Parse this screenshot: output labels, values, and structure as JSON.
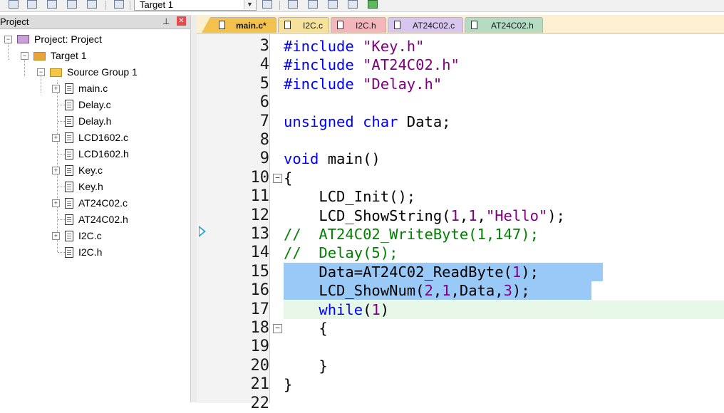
{
  "toolbar": {
    "target_value": "Target 1"
  },
  "project": {
    "title": "Project",
    "tree": [
      {
        "label": "Project: Project",
        "kind": "project",
        "level": 0,
        "expander": "−"
      },
      {
        "label": "Target 1",
        "kind": "target",
        "level": 1,
        "expander": "−"
      },
      {
        "label": "Source Group 1",
        "kind": "folder",
        "level": 2,
        "expander": "−"
      },
      {
        "label": "main.c",
        "kind": "file",
        "level": 3,
        "expander": "+"
      },
      {
        "label": "Delay.c",
        "kind": "file",
        "level": 3,
        "expander": ""
      },
      {
        "label": "Delay.h",
        "kind": "file",
        "level": 3,
        "expander": ""
      },
      {
        "label": "LCD1602.c",
        "kind": "file",
        "level": 3,
        "expander": "+"
      },
      {
        "label": "LCD1602.h",
        "kind": "file",
        "level": 3,
        "expander": ""
      },
      {
        "label": "Key.c",
        "kind": "file",
        "level": 3,
        "expander": "+"
      },
      {
        "label": "Key.h",
        "kind": "file",
        "level": 3,
        "expander": ""
      },
      {
        "label": "AT24C02.c",
        "kind": "file",
        "level": 3,
        "expander": "+"
      },
      {
        "label": "AT24C02.h",
        "kind": "file",
        "level": 3,
        "expander": ""
      },
      {
        "label": "I2C.c",
        "kind": "file",
        "level": 3,
        "expander": "+"
      },
      {
        "label": "I2C.h",
        "kind": "file",
        "level": 3,
        "expander": ""
      }
    ]
  },
  "tabs": [
    "main.c*",
    "I2C.c",
    "I2C.h",
    "AT24C02.c",
    "AT24C02.h"
  ],
  "editor": {
    "lines": [
      {
        "n": "3",
        "fold": "",
        "code": "#include \"Key.h\""
      },
      {
        "n": "4",
        "fold": "",
        "code": "#include \"AT24C02.h\""
      },
      {
        "n": "5",
        "fold": "",
        "code": "#include \"Delay.h\""
      },
      {
        "n": "6",
        "fold": "",
        "code": ""
      },
      {
        "n": "7",
        "fold": "",
        "code": "unsigned char Data;"
      },
      {
        "n": "8",
        "fold": "",
        "code": ""
      },
      {
        "n": "9",
        "fold": "",
        "code": "void main()"
      },
      {
        "n": "10",
        "fold": "⊟",
        "code": "{"
      },
      {
        "n": "11",
        "fold": "",
        "code": "    LCD_Init();"
      },
      {
        "n": "12",
        "fold": "",
        "code": "    LCD_ShowString(1,1,\"Hello\");"
      },
      {
        "n": "13",
        "fold": "",
        "code": "//  AT24C02_WriteByte(1,147);"
      },
      {
        "n": "14",
        "fold": "",
        "code": "//  Delay(5);"
      },
      {
        "n": "15",
        "fold": "",
        "code": "    Data=AT24C02_ReadByte(1);"
      },
      {
        "n": "16",
        "fold": "",
        "code": "    LCD_ShowNum(2,1,Data,3);"
      },
      {
        "n": "17",
        "fold": "",
        "code": "    while(1)"
      },
      {
        "n": "18",
        "fold": "⊟",
        "code": "    {"
      },
      {
        "n": "19",
        "fold": "",
        "code": ""
      },
      {
        "n": "20",
        "fold": "",
        "code": "    }"
      },
      {
        "n": "21",
        "fold": "",
        "code": "}"
      },
      {
        "n": "22",
        "fold": "",
        "code": ""
      }
    ]
  },
  "colors": {
    "keyword": "#0000ff",
    "string": "#800080",
    "comment": "#008000",
    "selection": "#99c9f7",
    "current_line": "#e7f7e7"
  }
}
